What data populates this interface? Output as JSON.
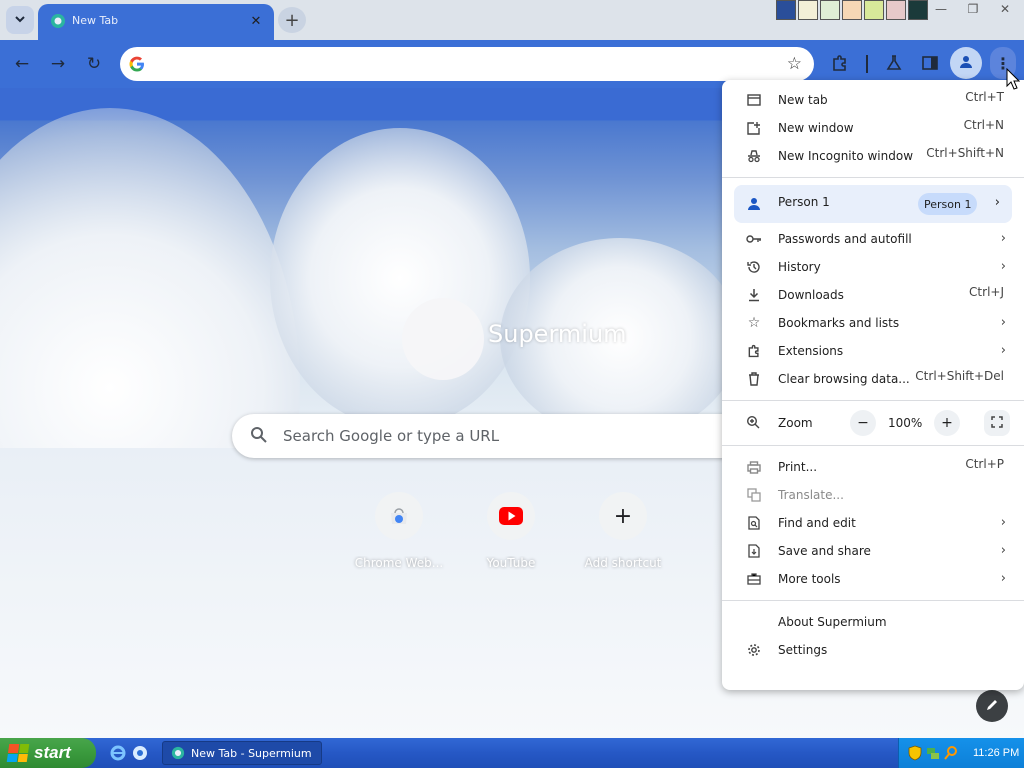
{
  "browser": {
    "tab": {
      "title": "New Tab"
    },
    "omnibox": {
      "value": "",
      "placeholder": ""
    },
    "accent": "#3b6fd6"
  },
  "page": {
    "brand": "Supermium",
    "search_placeholder": "Search Google or type a URL",
    "shortcuts": [
      {
        "label": "Chrome Web...",
        "icon": "chrome-web-store-icon"
      },
      {
        "label": "YouTube",
        "icon": "youtube-icon"
      },
      {
        "label": "Add shortcut",
        "icon": "plus-icon"
      }
    ]
  },
  "menu": {
    "group1": [
      {
        "label": "New tab",
        "shortcut": "Ctrl+T",
        "icon": "new-tab-icon"
      },
      {
        "label": "New window",
        "shortcut": "Ctrl+N",
        "icon": "new-window-icon"
      },
      {
        "label": "New Incognito window",
        "shortcut": "Ctrl+Shift+N",
        "icon": "incognito-icon"
      }
    ],
    "person": {
      "label": "Person 1",
      "chip": "Person 1"
    },
    "group2": [
      {
        "label": "Passwords and autofill",
        "icon": "key-icon"
      },
      {
        "label": "History",
        "icon": "history-icon"
      },
      {
        "label": "Downloads",
        "shortcut": "Ctrl+J",
        "icon": "download-icon"
      },
      {
        "label": "Bookmarks and lists",
        "icon": "star-icon"
      },
      {
        "label": "Extensions",
        "icon": "puzzle-icon"
      },
      {
        "label": "Clear browsing data...",
        "shortcut": "Ctrl+Shift+Del",
        "icon": "trash-icon"
      }
    ],
    "zoom": {
      "label": "Zoom",
      "value": "100%",
      "minus": "−",
      "plus": "+"
    },
    "group3": [
      {
        "label": "Print...",
        "shortcut": "Ctrl+P",
        "icon": "print-icon"
      },
      {
        "label": "Translate...",
        "icon": "translate-icon"
      },
      {
        "label": "Find and edit",
        "icon": "find-icon"
      },
      {
        "label": "Save and share",
        "icon": "save-icon"
      },
      {
        "label": "More tools",
        "icon": "toolbox-icon"
      }
    ],
    "group4": [
      {
        "label": "About Supermium"
      },
      {
        "label": "Settings",
        "icon": "gear-icon"
      }
    ]
  },
  "taskbar": {
    "start": "start",
    "task": "New Tab - Supermium",
    "clock": "11:26 PM"
  }
}
